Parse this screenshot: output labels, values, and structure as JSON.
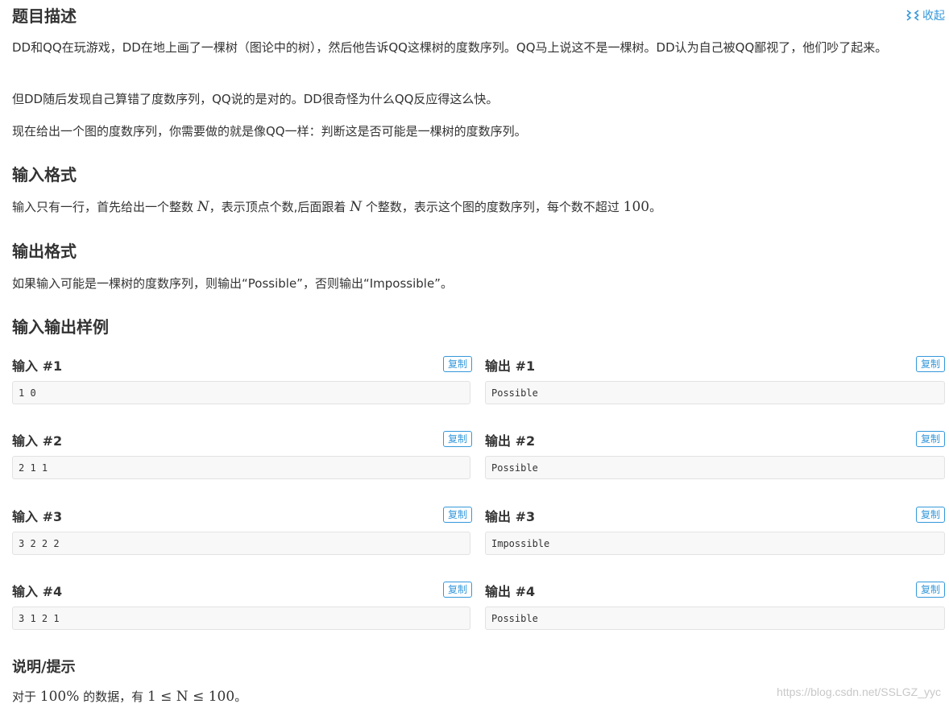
{
  "description": {
    "title": "题目描述",
    "collapse_label": "收起",
    "paragraphs": [
      "DD和QQ在玩游戏，DD在地上画了一棵树（图论中的树），然后他告诉QQ这棵树的度数序列。QQ马上说这不是一棵树。DD认为自己被QQ鄙视了，他们吵了起来。",
      "但DD随后发现自己算错了度数序列，QQ说的是对的。DD很奇怪为什么QQ反应得这么快。",
      "现在给出一个图的度数序列，你需要做的就是像QQ一样：判断这是否可能是一棵树的度数序列。"
    ]
  },
  "input_format": {
    "title": "输入格式",
    "text_1": "输入只有一行，首先给出一个整数 ",
    "var_n": "N",
    "text_2": "，表示顶点个数,后面跟着 ",
    "text_3": " 个整数，表示这个图的度数序列，每个数不超过 ",
    "max_value": "100",
    "text_4": "。"
  },
  "output_format": {
    "title": "输出格式",
    "text": "如果输入可能是一棵树的度数序列，则输出“Possible”，否则输出“Impossible”。"
  },
  "samples": {
    "title": "输入输出样例",
    "copy_label": "复制",
    "items": [
      {
        "input_label": "输入 #1",
        "output_label": "输出 #1",
        "input": "1 0",
        "output": "Possible"
      },
      {
        "input_label": "输入 #2",
        "output_label": "输出 #2",
        "input": "2 1 1",
        "output": "Possible"
      },
      {
        "input_label": "输入 #3",
        "output_label": "输出 #3",
        "input": "3 2 2 2",
        "output": "Impossible"
      },
      {
        "input_label": "输入 #4",
        "output_label": "输出 #4",
        "input": "3 1 2 1",
        "output": "Possible"
      }
    ]
  },
  "hint": {
    "title": "说明/提示",
    "text_1": "对于 ",
    "percent": "100%",
    "text_2": " 的数据，有 ",
    "constraint": "1 ≤ N ≤ 100",
    "text_3": "。"
  },
  "watermark": "https://blog.csdn.net/SSLGZ_yyc",
  "colors": {
    "accent": "#3498db",
    "text": "#333333",
    "code_bg": "#f8f8f8",
    "code_border": "#e2e2e2"
  }
}
